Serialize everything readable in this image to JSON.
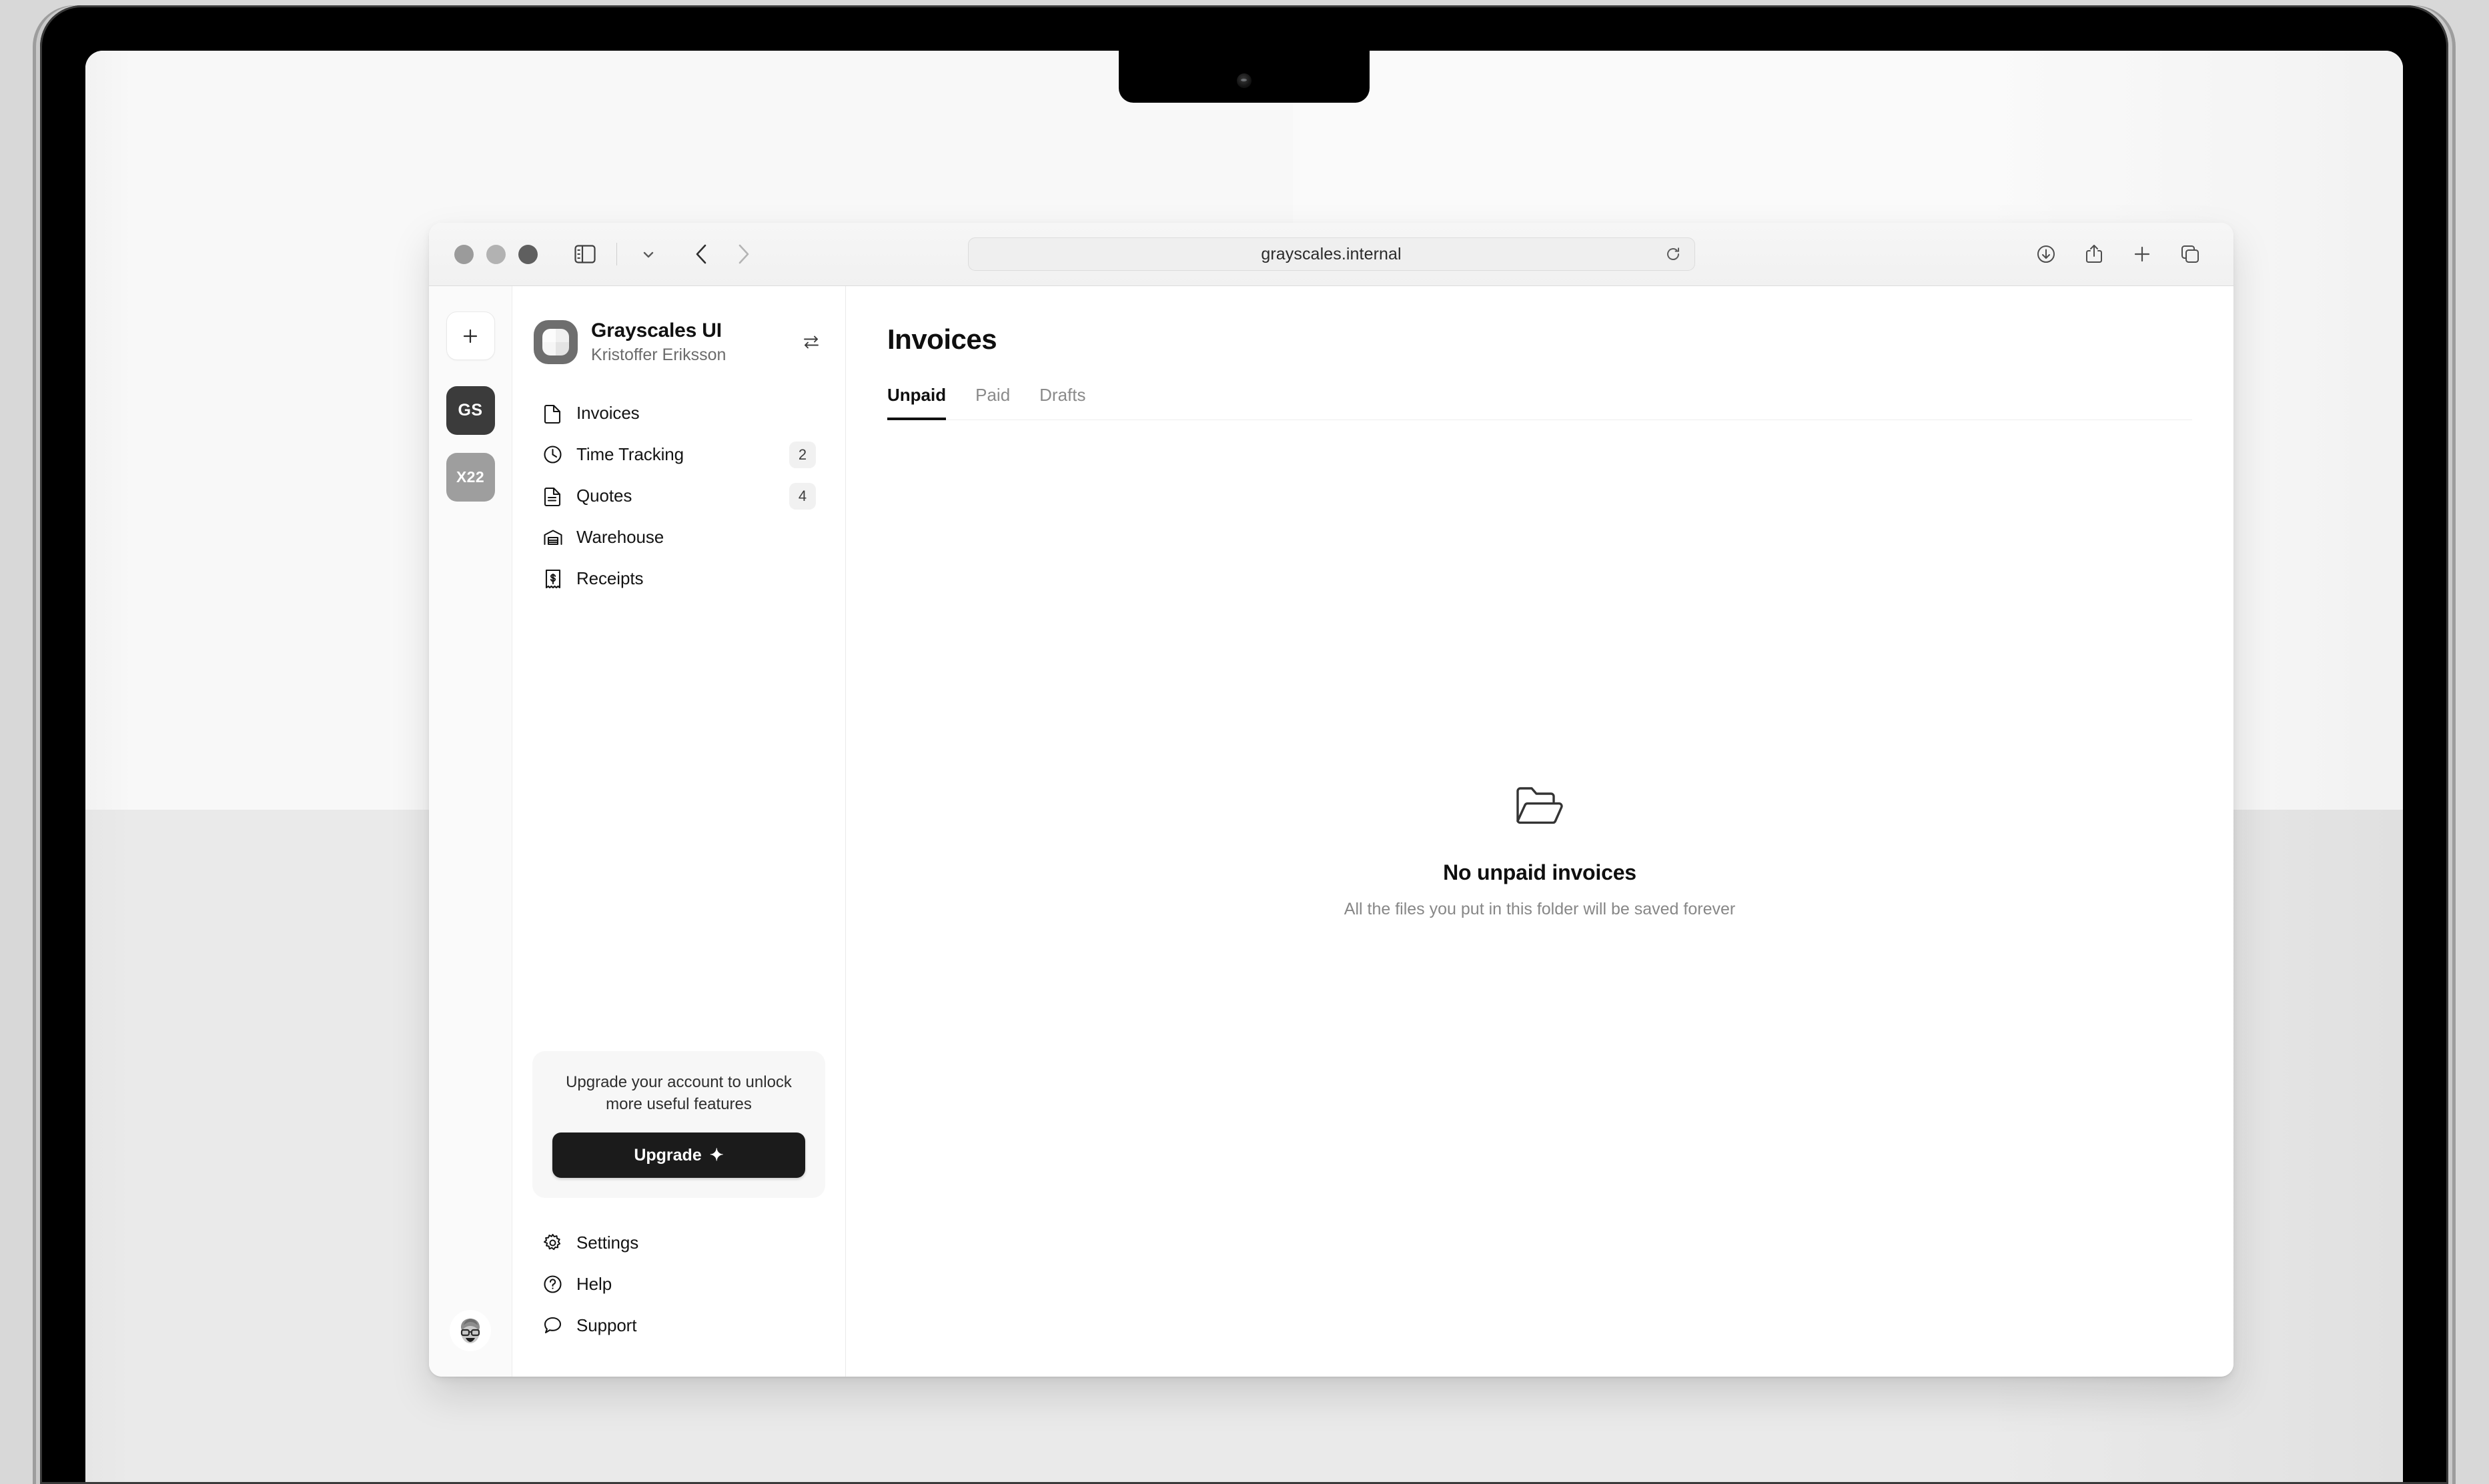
{
  "browser": {
    "url": "grayscales.internal",
    "window_controls": [
      "close",
      "minimize",
      "maximize"
    ],
    "sidebar_toggle_icon": "sidebar-icon",
    "tab_overview_dropdown_icon": "chevron-down-icon",
    "back_icon": "chevron-left-icon",
    "forward_icon": "chevron-right-icon",
    "reload_icon": "reload-icon",
    "right_actions": [
      {
        "name": "downloads-icon"
      },
      {
        "name": "share-icon"
      },
      {
        "name": "new-tab-icon"
      },
      {
        "name": "tab-overview-icon"
      }
    ]
  },
  "rail": {
    "add_icon": "plus-icon",
    "workspaces": [
      {
        "label": "GS",
        "color": "#3b3b3b",
        "active": true
      },
      {
        "label": "X22",
        "color": "#9e9e9e",
        "active": false
      }
    ],
    "avatar_icon": "user-avatar"
  },
  "sidebar": {
    "workspace_name": "Grayscales UI",
    "workspace_user": "Kristoffer Eriksson",
    "switch_icon": "swap-arrows-icon",
    "nav_items": [
      {
        "label": "Invoices",
        "icon": "file-icon",
        "badge": ""
      },
      {
        "label": "Time Tracking",
        "icon": "clock-icon",
        "badge": "2"
      },
      {
        "label": "Quotes",
        "icon": "document-icon",
        "badge": "4"
      },
      {
        "label": "Warehouse",
        "icon": "warehouse-icon",
        "badge": ""
      },
      {
        "label": "Receipts",
        "icon": "receipt-icon",
        "badge": ""
      }
    ],
    "upgrade": {
      "text": "Upgrade your account to unlock more useful features",
      "button_label": "Upgrade",
      "sparkle": "✦"
    },
    "footer_items": [
      {
        "label": "Settings",
        "icon": "gear-icon"
      },
      {
        "label": "Help",
        "icon": "question-circle-icon"
      },
      {
        "label": "Support",
        "icon": "chat-bubble-icon"
      }
    ]
  },
  "main": {
    "title": "Invoices",
    "tabs": [
      {
        "label": "Unpaid",
        "active": true
      },
      {
        "label": "Paid",
        "active": false
      },
      {
        "label": "Drafts",
        "active": false
      }
    ],
    "empty_state": {
      "icon": "open-folder-icon",
      "title": "No unpaid invoices",
      "subtitle": "All the files you put in this folder will be saved forever"
    }
  },
  "theme": {
    "accent": "#1b1b1b",
    "badge_bg": "#f1f1f1",
    "muted_text": "#878787"
  }
}
